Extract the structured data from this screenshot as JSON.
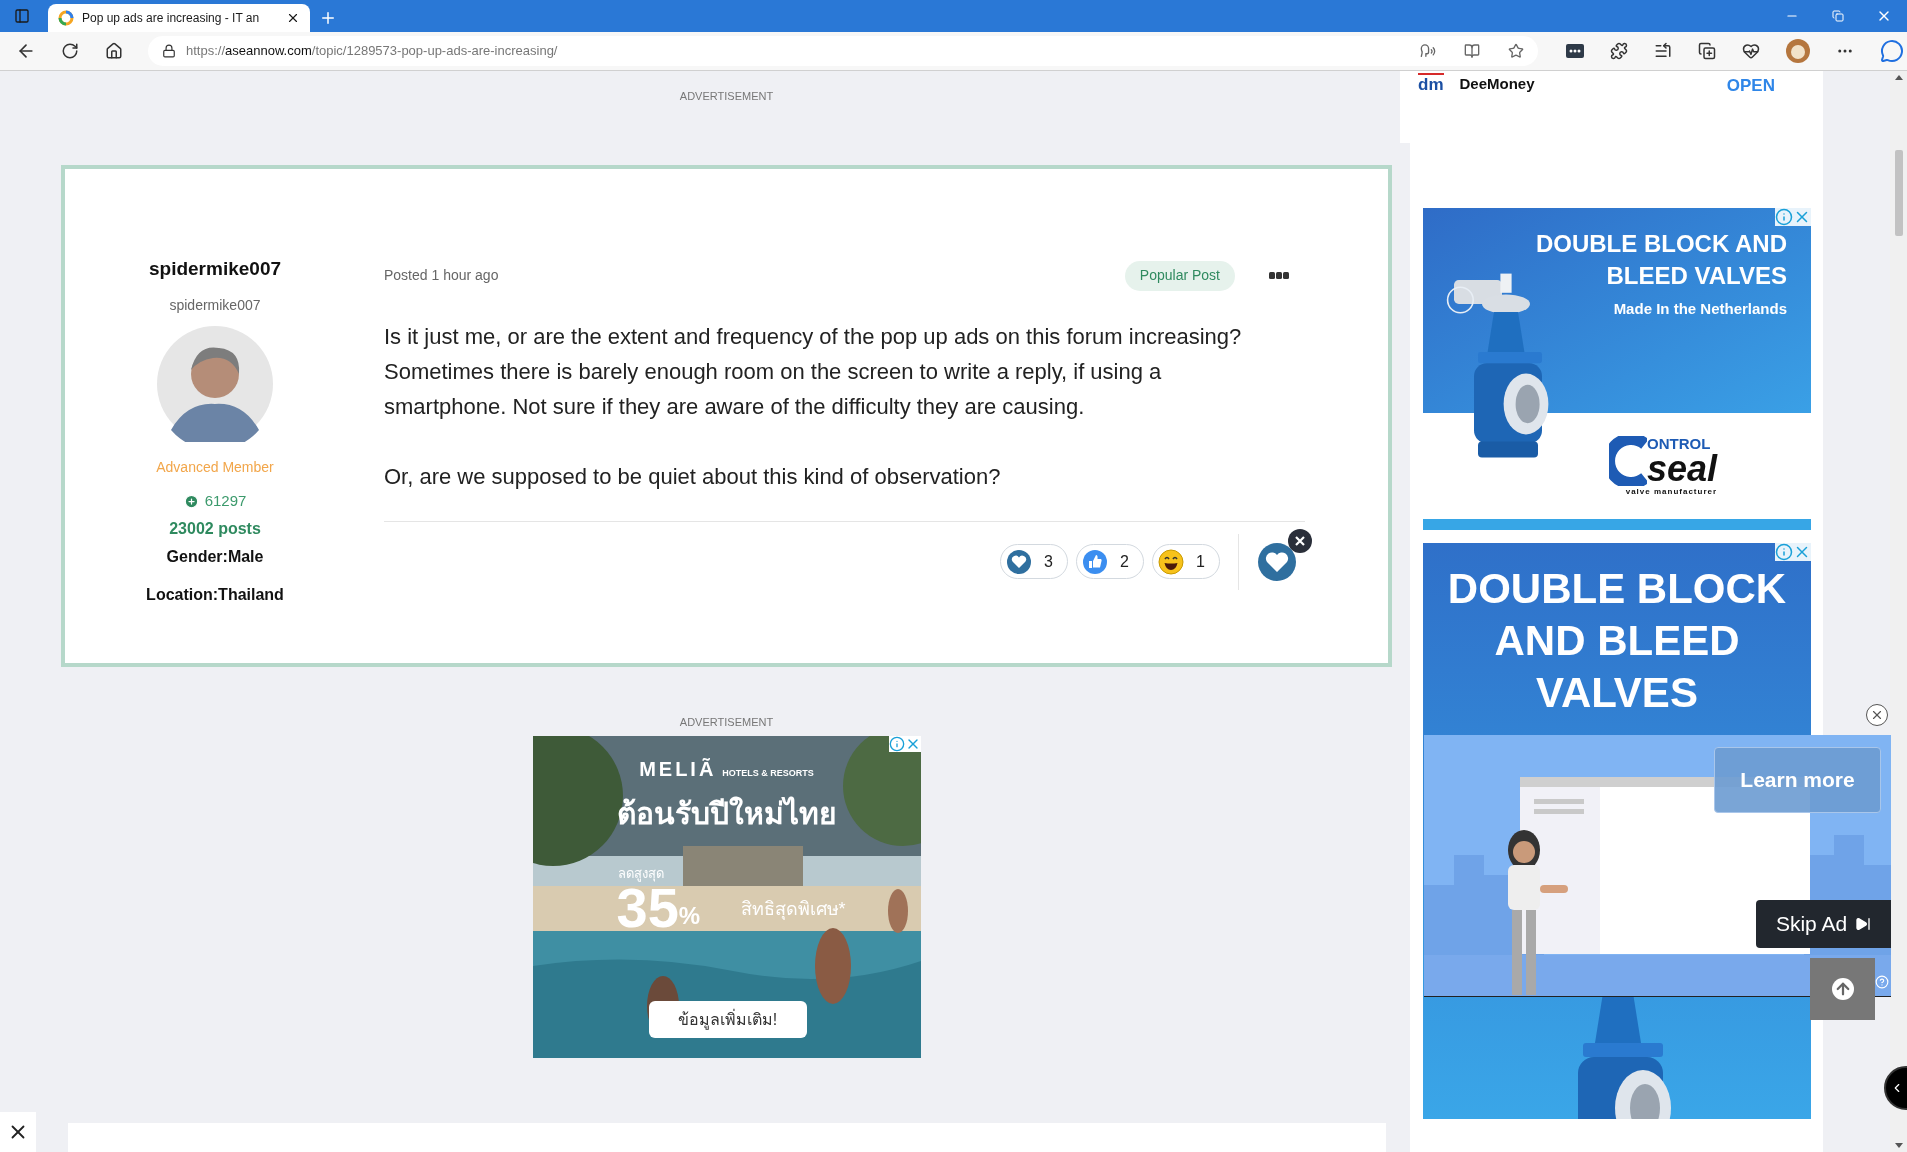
{
  "browser": {
    "tabs": [
      {
        "title": "Pop up ads are increasing - IT an",
        "selected": true
      }
    ],
    "address": {
      "scheme": "https://",
      "host": "aseannow.com",
      "path": "/topic/1289573-pop-up-ads-are-increasing/"
    }
  },
  "main": {
    "ad_label_top": "ADVERTISEMENT",
    "post": {
      "author": "spidermike007",
      "handle": "spidermike007",
      "rank": "Advanced Member",
      "reputation": "61297",
      "posts": "23002 posts",
      "gender": "Gender:Male",
      "location": "Location:Thailand",
      "posted": "Posted 1 hour ago",
      "badge": "Popular Post",
      "paragraphs": [
        "Is it just me, or are the extent and frequency of the pop up ads on this forum increasing? Sometimes there is barely enough room on the screen to write a reply, if using a smartphone. Not sure if they are aware of the difficulty they are causing.",
        "Or, are we supposed to be quiet about this kind of observation?"
      ],
      "reactions": [
        {
          "kind": "heart",
          "count": "3"
        },
        {
          "kind": "like",
          "count": "2"
        },
        {
          "kind": "laugh",
          "count": "1"
        }
      ]
    },
    "ad_label_bottom": "ADVERTISEMENT",
    "hotel_ad": {
      "brand": "MELIÃ",
      "brand_sub": "HOTELS & RESORTS",
      "headline": "ต้อนรับปีใหม่ไทย",
      "discount_label": "ลดสูงสุด",
      "discount": "35",
      "percent": "%",
      "perk": "สิทธิสุดพิเศษ*",
      "button": "ข้อมูลเพิ่มเติม!"
    }
  },
  "sidebar": {
    "sponsor": {
      "logo": "dm",
      "name": "DeeMoney",
      "action": "OPEN"
    },
    "valve_ad_1": {
      "title_lines": [
        "DOUBLE BLOCK AND",
        "BLEED VALVES"
      ],
      "subtitle": "Made In the Netherlands",
      "logo_top": "ONTROL",
      "logo_main": "seal",
      "logo_sub": "valve manufacturer"
    },
    "valve_ad_2": {
      "title_lines": [
        "DOUBLE BLOCK",
        "AND BLEED",
        "VALVES"
      ]
    }
  },
  "video_ad": {
    "button": "Learn more",
    "skip": "Skip Ad"
  }
}
